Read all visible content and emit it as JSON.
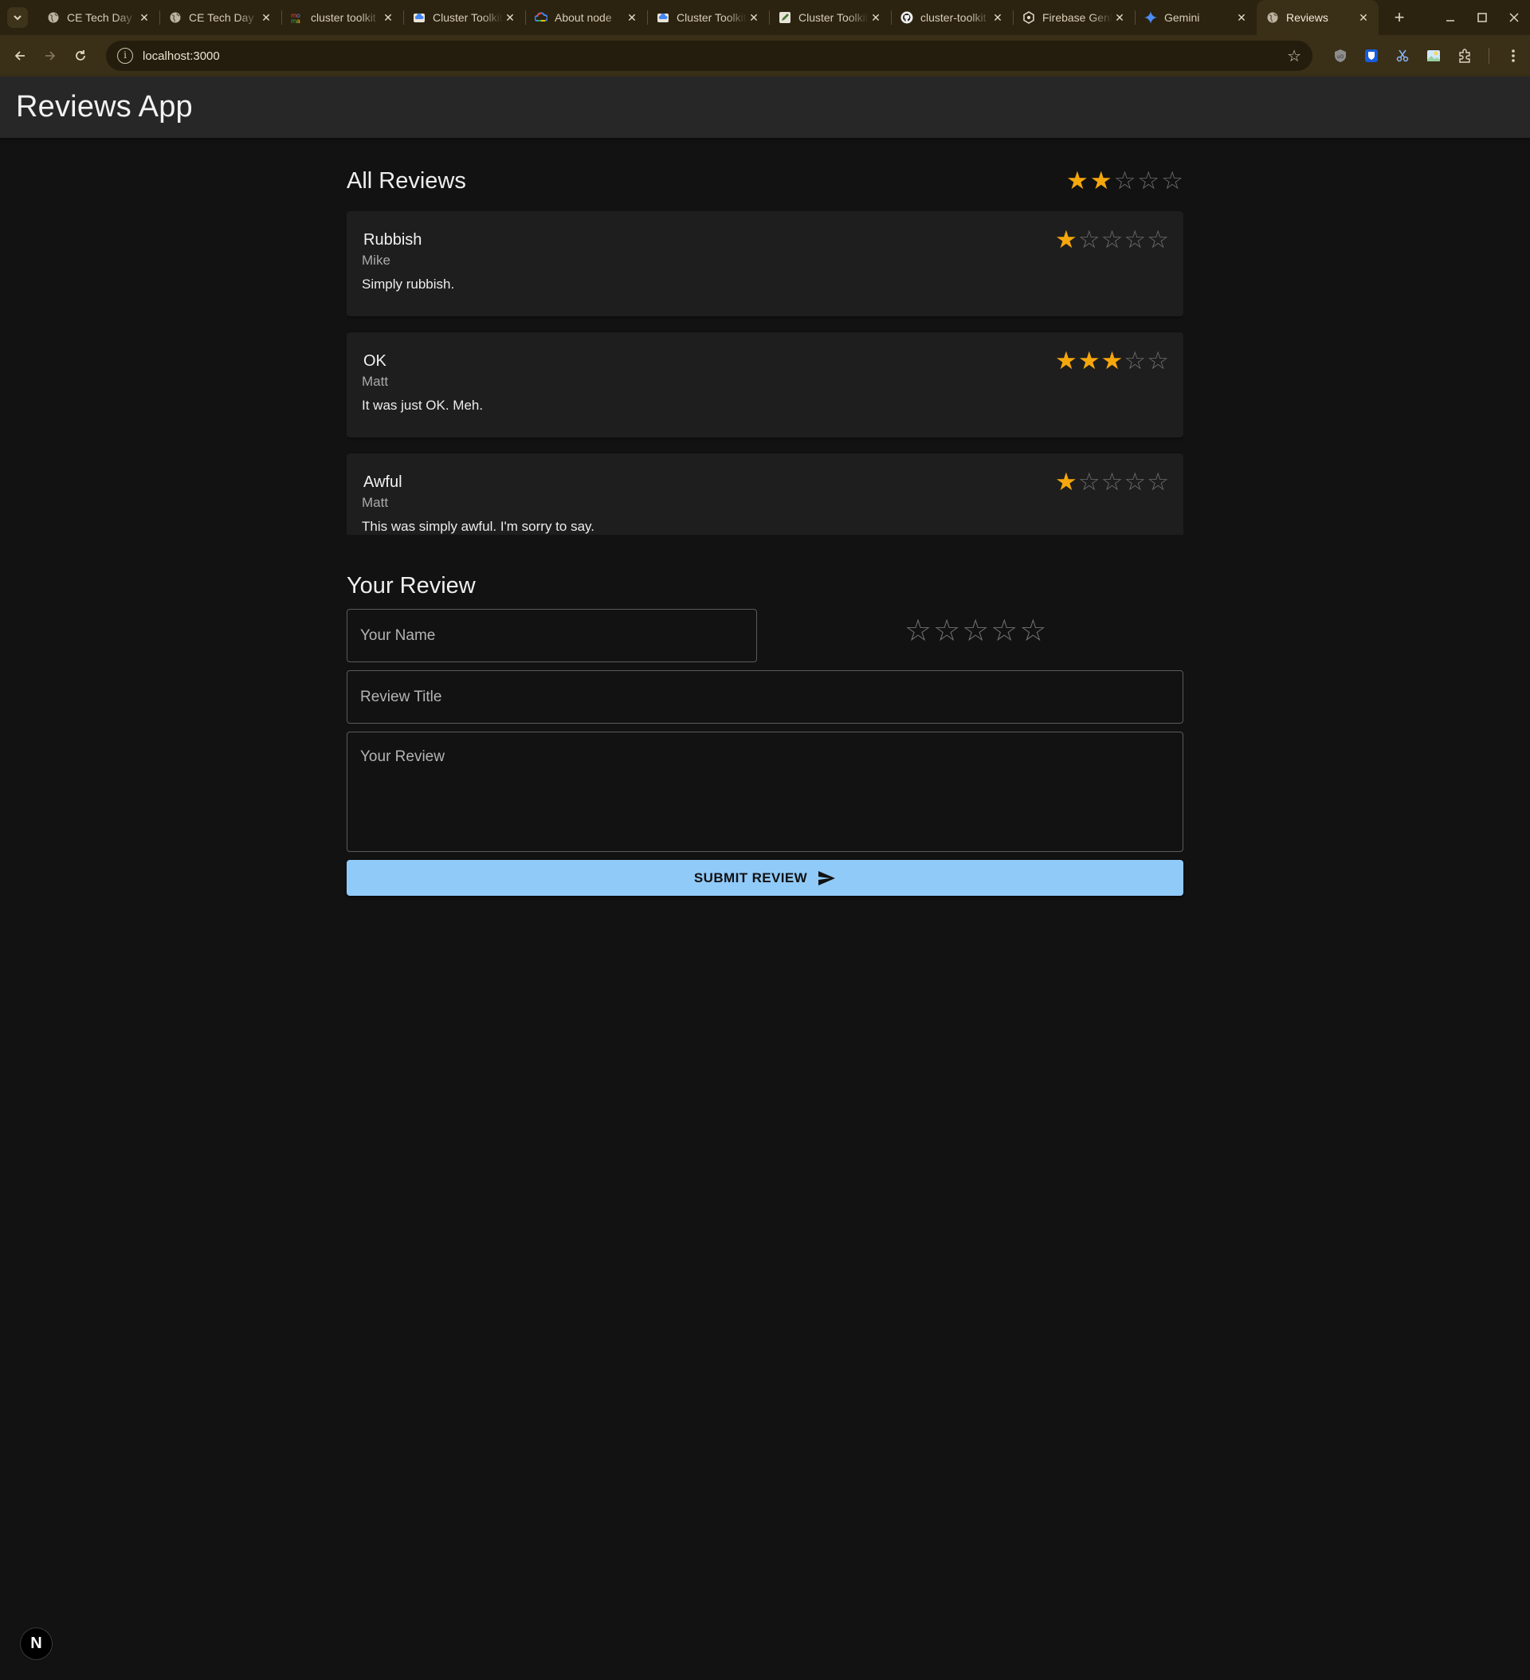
{
  "browser": {
    "tabs": [
      {
        "title": "CE Tech Day",
        "icon": "globe-icon",
        "active": false
      },
      {
        "title": "CE Tech Day",
        "icon": "globe-icon",
        "active": false
      },
      {
        "title": "cluster toolkit",
        "icon": "moma-icon",
        "active": false
      },
      {
        "title": "Cluster Toolkit",
        "icon": "cloud-docs-icon",
        "active": false
      },
      {
        "title": "About node",
        "icon": "google-cloud-icon",
        "active": false
      },
      {
        "title": "Cluster Toolkit",
        "icon": "cloud-docs-icon",
        "active": false
      },
      {
        "title": "Cluster Toolkit",
        "icon": "edit-doc-icon",
        "active": false
      },
      {
        "title": "cluster-toolkit",
        "icon": "github-icon",
        "active": false
      },
      {
        "title": "Firebase Genkit",
        "icon": "firebase-genkit-icon",
        "active": false
      },
      {
        "title": "Gemini",
        "icon": "gemini-sparkle-icon",
        "active": false
      },
      {
        "title": "Reviews",
        "icon": "globe-icon",
        "active": true
      }
    ],
    "url": "localhost:3000"
  },
  "app": {
    "title": "Reviews App"
  },
  "all_reviews": {
    "heading": "All Reviews",
    "average_rating": 2,
    "max_rating": 5,
    "reviews": [
      {
        "title": "Rubbish",
        "author": "Mike",
        "body": "Simply rubbish.",
        "rating": 1
      },
      {
        "title": "OK",
        "author": "Matt",
        "body": "It was just OK. Meh.",
        "rating": 3
      },
      {
        "title": "Awful",
        "author": "Matt",
        "body": "This was simply awful. I'm sorry to say.",
        "rating": 1
      }
    ]
  },
  "form": {
    "heading": "Your Review",
    "name_placeholder": "Your Name",
    "title_placeholder": "Review Title",
    "body_placeholder": "Your Review",
    "rating": 0,
    "submit_label": "SUBMIT REVIEW"
  },
  "dev_badge": {
    "label": "N"
  },
  "colors": {
    "star_filled": "#f5a70c",
    "star_empty": "#6d6d6d",
    "submit_button": "#90caf9",
    "background": "#121212",
    "card": "#1e1e1e",
    "appbar": "#272727"
  }
}
